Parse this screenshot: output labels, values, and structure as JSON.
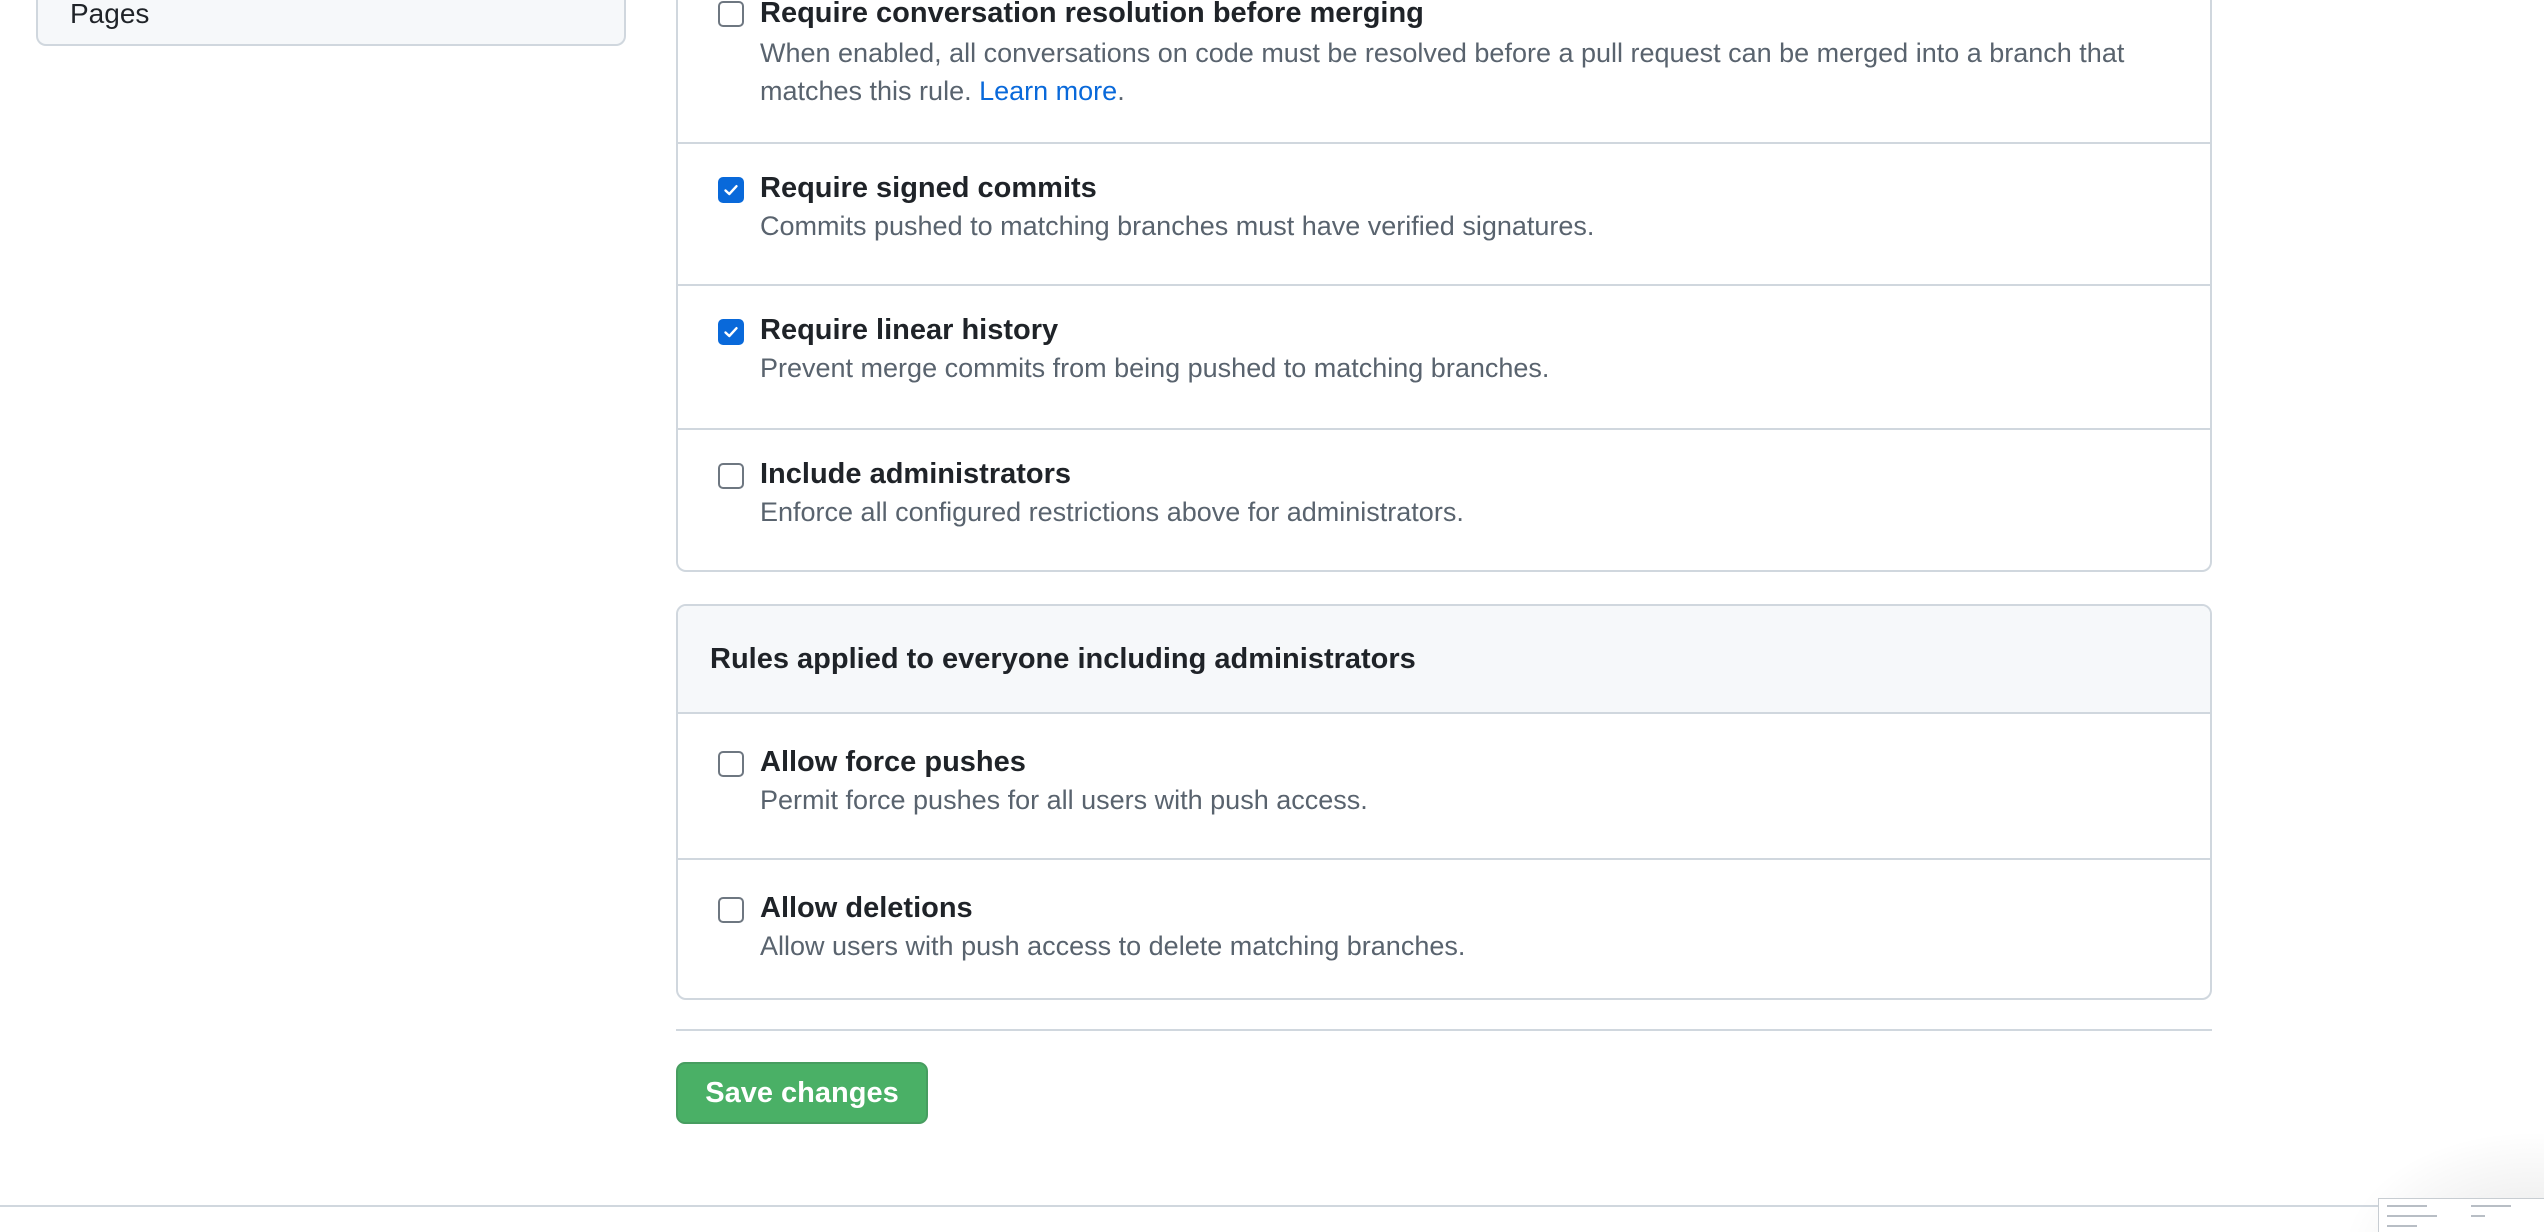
{
  "sidebar": {
    "last_item": "Pages"
  },
  "protection_rules": [
    {
      "title": "Require conversation resolution before merging",
      "description": "When enabled, all conversations on code must be resolved before a pull request can be merged into a branch that matches this rule.",
      "link": "Learn more",
      "trailing": ".",
      "checked": false
    },
    {
      "title": "Require signed commits",
      "description": "Commits pushed to matching branches must have verified signatures.",
      "checked": true
    },
    {
      "title": "Require linear history",
      "description": "Prevent merge commits from being pushed to matching branches.",
      "checked": true
    },
    {
      "title": "Include administrators",
      "description": "Enforce all configured restrictions above for administrators.",
      "checked": false
    }
  ],
  "everyone_section": {
    "title": "Rules applied to everyone including administrators",
    "rules": [
      {
        "title": "Allow force pushes",
        "description": "Permit force pushes for all users with push access.",
        "checked": false
      },
      {
        "title": "Allow deletions",
        "description": "Allow users with push access to delete matching branches.",
        "checked": false
      }
    ]
  },
  "actions": {
    "save_label": "Save changes"
  },
  "colors": {
    "accent": "#0969da",
    "save_green": "#2da44e",
    "border": "#d0d7de",
    "muted_text": "#59636e"
  }
}
